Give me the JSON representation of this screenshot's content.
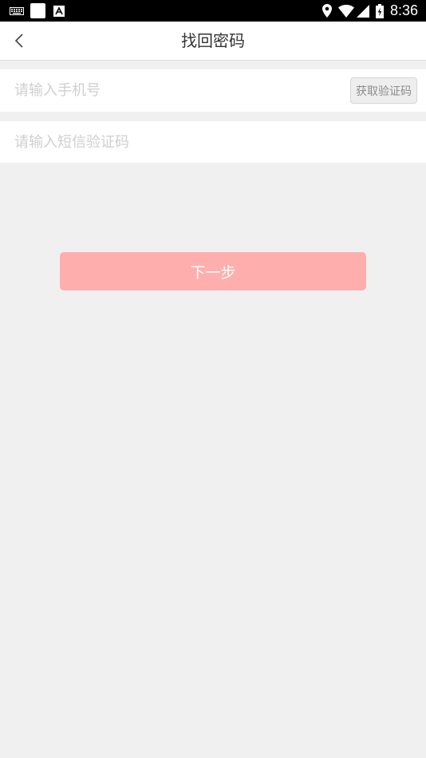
{
  "status_bar": {
    "time": "8:36",
    "left_icons": [
      "keyboard-icon",
      "blank-notification-icon",
      "a-badge-icon"
    ],
    "right_icons": [
      "location-icon",
      "wifi-icon",
      "signal-icon",
      "battery-icon"
    ]
  },
  "header": {
    "title": "找回密码",
    "back_icon": "chevron-left-icon"
  },
  "form": {
    "phone_placeholder": "请输入手机号",
    "get_code_label": "获取验证码",
    "sms_code_placeholder": "请输入短信验证码"
  },
  "actions": {
    "next_label": "下一步"
  },
  "colors": {
    "background": "#f0f0f0",
    "accent_disabled": "#ffaeae",
    "status_bar": "#000000"
  }
}
